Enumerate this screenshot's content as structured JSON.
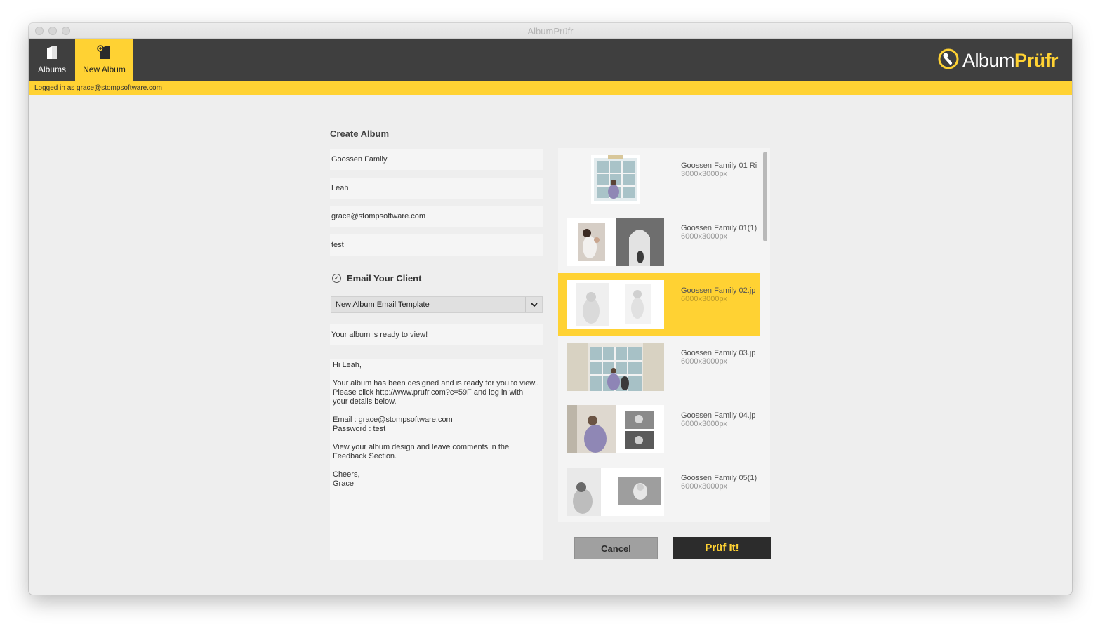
{
  "window": {
    "title": "AlbumPrüfr"
  },
  "toolbar": {
    "albums_label": "Albums",
    "new_album_label": "New Album",
    "logo_part1": "Album",
    "logo_part2": "Prüfr"
  },
  "status": {
    "logged_in": "Logged in as grace@stompsoftware.com"
  },
  "form": {
    "title": "Create Album",
    "album_name": "Goossen Family",
    "client_name": "Leah",
    "client_email": "grace@stompsoftware.com",
    "password": "test",
    "email_client_label": "Email Your Client",
    "email_client_checked": true,
    "template_selected": "New Album Email Template",
    "subject": "Your album is ready to view!",
    "body": "Hi Leah,\n\nYour album has been designed and is ready for you to view..  Please click http://www.prufr.com?c=59F and log in with your details below.\n\nEmail : grace@stompsoftware.com\nPassword : test\n\nView your album design and leave comments in the Feedback Section.\n\nCheers,\nGrace"
  },
  "spreads": [
    {
      "name": "Goossen Family 01 Ri",
      "size": "3000x3000px",
      "selected": false
    },
    {
      "name": "Goossen Family 01(1)",
      "size": "6000x3000px",
      "selected": false
    },
    {
      "name": "Goossen Family 02.jp",
      "size": "6000x3000px",
      "selected": true
    },
    {
      "name": "Goossen Family 03.jp",
      "size": "6000x3000px",
      "selected": false
    },
    {
      "name": "Goossen Family 04.jp",
      "size": "6000x3000px",
      "selected": false
    },
    {
      "name": "Goossen Family 05(1)",
      "size": "6000x3000px",
      "selected": false
    }
  ],
  "actions": {
    "cancel": "Cancel",
    "submit": "Prüf It!"
  },
  "colors": {
    "accent": "#ffd233",
    "toolbar": "#3f3f3f",
    "submit_bg": "#2c2c2c"
  }
}
